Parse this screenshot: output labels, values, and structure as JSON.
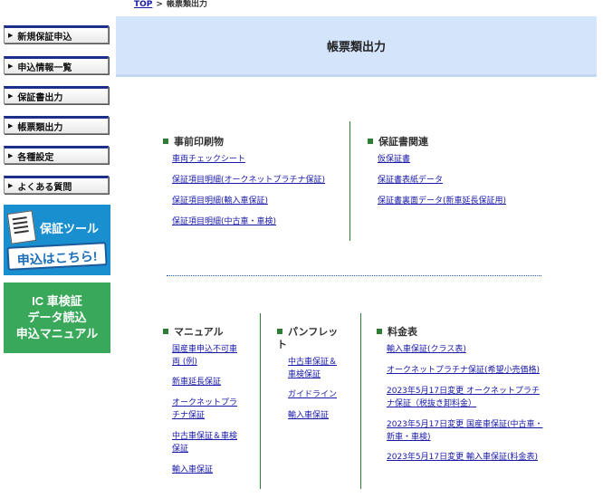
{
  "breadcrumb": {
    "home": "TOP",
    "separator": ">",
    "current": "帳票類出力"
  },
  "sidebar": {
    "items": [
      {
        "label": "新規保証申込"
      },
      {
        "label": "申込情報一覧"
      },
      {
        "label": "保証書出力"
      },
      {
        "label": "帳票類出力"
      },
      {
        "label": "各種設定"
      },
      {
        "label": "よくある質問"
      }
    ],
    "banner_tool": {
      "line1": "保証ツール",
      "line2": "申込はこちら!"
    },
    "banner_ic": {
      "line1": "IC 車検証",
      "line2": "データ読込",
      "line3": "申込マニュアル"
    }
  },
  "page_title": "帳票類出力",
  "sections": {
    "preprint": {
      "title": "事前印刷物",
      "links": [
        "車両チェックシート",
        "保証項目明細(オークネットプラチナ保証)",
        "保証項目明細(輸入車保証)",
        "保証項目明細(中古車・車検)"
      ]
    },
    "warranty_docs": {
      "title": "保証書関連",
      "links": [
        "仮保証書",
        "保証書表紙データ",
        "保証書裏面データ(新車延長保証用)"
      ]
    },
    "manual": {
      "title": "マニュアル",
      "links": [
        [
          "国産車申込不可車",
          "両 (例)"
        ],
        [
          "新車延長保証"
        ],
        [
          "オークネットプラ",
          "チナ保証"
        ],
        [
          "中古車保証＆車検",
          "保証"
        ],
        [
          "輸入車保証"
        ]
      ]
    },
    "pamphlet": {
      "title_lines": [
        "パンフレッ",
        "ト"
      ],
      "links": [
        [
          "中古車保証＆",
          "車検保証"
        ],
        [
          "ガイドライン"
        ],
        [
          "輸入車保証"
        ]
      ]
    },
    "fees": {
      "title": "料金表",
      "links": [
        [
          "輸入車保証(クラス表)"
        ],
        [
          "オークネットプラチナ保証(希望小売価格)"
        ],
        [
          "2023年5月17日変更 オークネットプラチ",
          "ナ保証（税抜き卸料金）"
        ],
        [
          "2023年5月17日変更 国産車保証(中古車・",
          "新車・車検)"
        ],
        [
          "2023年5月17日変更 輸入車保証(料金表)"
        ]
      ]
    }
  },
  "colors": {
    "nav_border": "#1c2f8a",
    "title_bg": "#d3e4fb",
    "section_marker": "#2e7d32",
    "link": "#1a1aa8"
  }
}
